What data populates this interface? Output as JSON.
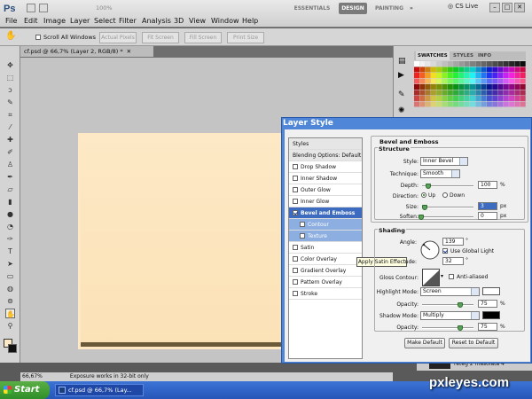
{
  "app": {
    "logo": "Ps",
    "menu": [
      "File",
      "Edit",
      "Image",
      "Layer",
      "Select",
      "Filter",
      "Analysis",
      "3D",
      "View",
      "Window",
      "Help"
    ],
    "zoom": "100%"
  },
  "workspaces": {
    "items": [
      "ESSENTIALS",
      "DESIGN",
      "PAINTING"
    ],
    "active": "DESIGN",
    "more": "»",
    "cslive": "CS Live"
  },
  "window_buttons": [
    "–",
    "□",
    "✕"
  ],
  "options": {
    "scroll_all": "Scroll All Windows",
    "buttons": [
      "Actual Pixels",
      "Fit Screen",
      "Fill Screen",
      "Print Size"
    ]
  },
  "document": {
    "tab": "cf.psd @ 66,7% (Layer 2, RGB/8) *",
    "zoom_status": "66,67%",
    "status_msg": "Exposure works in 32-bit only"
  },
  "panels": {
    "tabs": [
      "SWATCHES",
      "STYLES",
      "INFO"
    ],
    "layer_name": "réteg 2 másolata 4"
  },
  "dialog": {
    "title": "Layer Style",
    "styles": [
      {
        "label": "Styles",
        "kind": "hdr"
      },
      {
        "label": "Blending Options: Default",
        "kind": "hdr"
      },
      {
        "label": "Drop Shadow",
        "checked": false
      },
      {
        "label": "Inner Shadow",
        "checked": false
      },
      {
        "label": "Outer Glow",
        "checked": false
      },
      {
        "label": "Inner Glow",
        "checked": false
      },
      {
        "label": "Bevel and Emboss",
        "checked": true,
        "kind": "sel"
      },
      {
        "label": "Contour",
        "checked": false,
        "kind": "sub"
      },
      {
        "label": "Texture",
        "checked": false,
        "kind": "sub"
      },
      {
        "label": "Satin",
        "checked": false
      },
      {
        "label": "Color Overlay",
        "checked": false
      },
      {
        "label": "Gradient Overlay",
        "checked": false
      },
      {
        "label": "Pattern Overlay",
        "checked": false
      },
      {
        "label": "Stroke",
        "checked": false
      }
    ],
    "tooltip": "Apply Satin Effect",
    "bevel": {
      "title": "Bevel and Emboss",
      "structure_title": "Structure",
      "style_label": "Style:",
      "style_value": "Inner Bevel",
      "technique_label": "Technique:",
      "technique_value": "Smooth",
      "depth_label": "Depth:",
      "depth_value": "100",
      "depth_unit": "%",
      "direction_label": "Direction:",
      "dir_up": "Up",
      "dir_down": "Down",
      "size_label": "Size:",
      "size_value": "3",
      "size_unit": "px",
      "soften_label": "Soften:",
      "soften_value": "0",
      "soften_unit": "px"
    },
    "shading": {
      "title": "Shading",
      "angle_label": "Angle:",
      "angle_value": "139",
      "angle_unit": "°",
      "global_light": "Use Global Light",
      "altitude_label": "ude:",
      "altitude_value": "32",
      "altitude_unit": "°",
      "gloss_label": "Gloss Contour:",
      "anti_aliased": "Anti-aliased",
      "highlight_label": "Highlight Mode:",
      "highlight_value": "Screen",
      "highlight_color": "#ffffff",
      "h_opacity_label": "Opacity:",
      "h_opacity_value": "75",
      "h_opacity_unit": "%",
      "shadow_label": "Shadow Mode:",
      "shadow_value": "Multiply",
      "shadow_color": "#000000",
      "s_opacity_label": "Opacity:",
      "s_opacity_value": "75",
      "s_opacity_unit": "%"
    },
    "make_default": "Make Default",
    "reset_default": "Reset to Default"
  },
  "taskbar": {
    "start": "Start",
    "item": "cf.psd @ 66,7% (Lay..."
  },
  "watermark": "pxleyes.com"
}
